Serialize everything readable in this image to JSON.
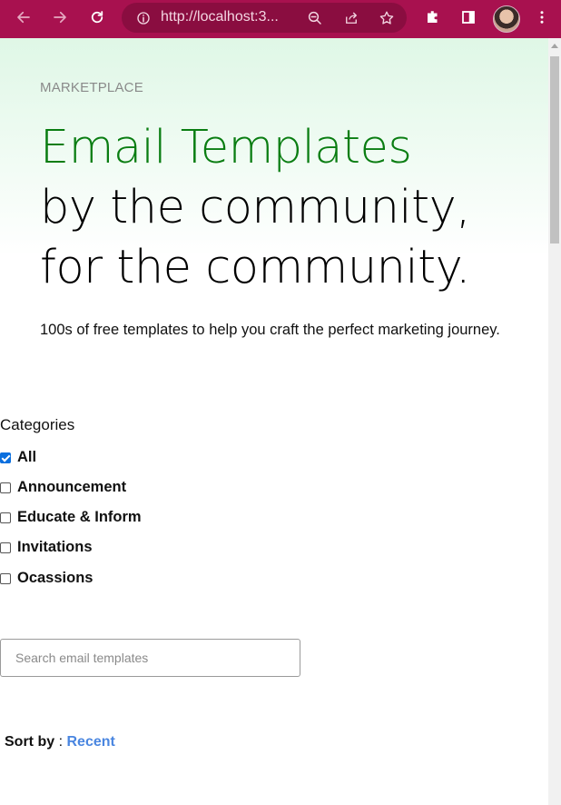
{
  "browser": {
    "url": "http://localhost:3...",
    "accent": "#a8114f"
  },
  "page": {
    "eyebrow": "MARKETPLACE",
    "headline": {
      "highlight": "Email Templates",
      "line2": "by the community,",
      "line3": "for the community."
    },
    "subtitle": "100s of free templates to help you craft the perfect marketing journey.",
    "categories": {
      "title": "Categories",
      "items": [
        {
          "label": "All",
          "checked": true
        },
        {
          "label": "Announcement",
          "checked": false
        },
        {
          "label": "Educate & Inform",
          "checked": false
        },
        {
          "label": "Invitations",
          "checked": false
        },
        {
          "label": "Ocassions",
          "checked": false
        }
      ]
    },
    "search": {
      "placeholder": "Search email templates",
      "value": ""
    },
    "sort": {
      "label": "Sort by",
      "separator": ":",
      "value": "Recent"
    }
  },
  "colors": {
    "headline_green": "#0a7d12",
    "link_blue": "#4a86e0",
    "checkbox_blue": "#0b6fde"
  },
  "icons": [
    "back-arrow-icon",
    "forward-arrow-icon",
    "reload-icon",
    "info-icon",
    "zoom-out-icon",
    "share-icon",
    "star-icon",
    "extensions-icon",
    "side-panel-icon",
    "kebab-menu-icon"
  ]
}
